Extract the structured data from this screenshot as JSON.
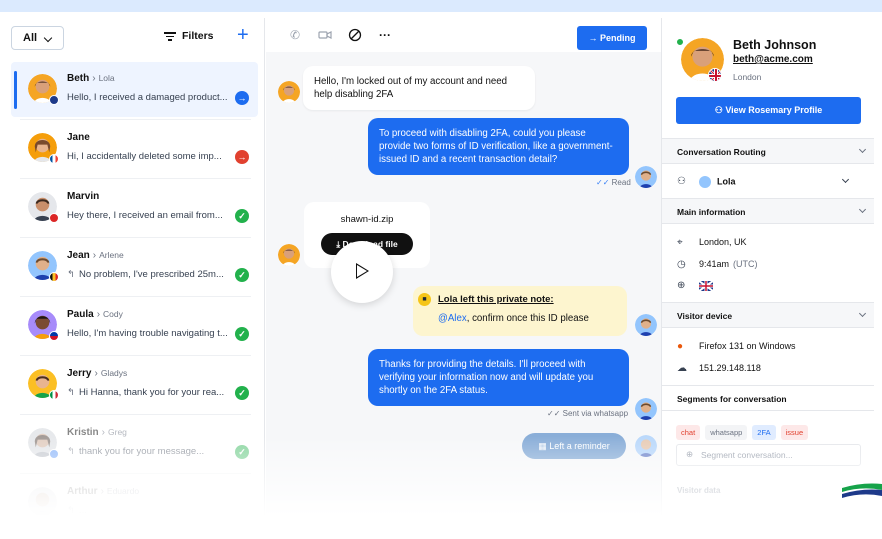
{
  "left": {
    "filter_all": "All",
    "filters_label": "Filters",
    "add_label": "+",
    "conversations": [
      {
        "name": "Beth",
        "agent": "Lola",
        "message": "Hello, I received a damaged product...",
        "status": "blue",
        "status_icon": "→",
        "reply": ""
      },
      {
        "name": "Jane",
        "agent": "",
        "message": "Hi, I accidentally deleted some imp...",
        "status": "red",
        "status_icon": "→",
        "reply": ""
      },
      {
        "name": "Marvin",
        "agent": "",
        "message": "Hey there, I received an email from...",
        "status": "green",
        "status_icon": "✓",
        "reply": ""
      },
      {
        "name": "Jean",
        "agent": "Arlene",
        "message": "No problem, I've prescribed 25m...",
        "status": "green",
        "status_icon": "✓",
        "reply": "↰"
      },
      {
        "name": "Paula",
        "agent": "Cody",
        "message": "Hello, I'm having trouble navigating t...",
        "status": "green",
        "status_icon": "✓",
        "reply": ""
      },
      {
        "name": "Jerry",
        "agent": "Gladys",
        "message": "Hi Hanna, thank you for your rea...",
        "status": "green",
        "status_icon": "✓",
        "reply": "↰"
      },
      {
        "name": "Kristin",
        "agent": "Greg",
        "message": "thank you for your message...",
        "status": "green",
        "status_icon": "✓",
        "reply": "↰"
      },
      {
        "name": "Arthur",
        "agent": "Eduardo",
        "message": "...",
        "status": "green",
        "status_icon": "✓",
        "reply": "↰"
      }
    ]
  },
  "middle": {
    "pending_label": "Pending",
    "msg1": "Hello, I'm locked out of my account and need help disabling 2FA",
    "msg2": "To proceed with disabling 2FA, could you please provide two forms of ID verification, like a government-issued ID and a recent transaction detail?",
    "msg2_meta": "Read",
    "file_name": "shawn-id.zip",
    "download_label": "Download file",
    "note_title": "Lola left this private note:",
    "note_mention": "@Alex",
    "note_body": ", confirm once this ID please",
    "msg3": "Thanks for providing the details. I'll proceed with verifying your information now and will update you shortly on the 2FA status.",
    "msg3_meta": "Sent via whatsapp",
    "reminder_label": "Left a reminder"
  },
  "right": {
    "name": "Beth Johnson",
    "email": "beth@acme.com",
    "location": "London",
    "view_profile": "View Rosemary Profile",
    "routing_title": "Conversation Routing",
    "routing_agent": "Lola",
    "main_info_title": "Main information",
    "city": "London, UK",
    "time": "9:41am",
    "timezone": "(UTC)",
    "device_title": "Visitor device",
    "browser": "Firefox 131 on Windows",
    "ip": "151.29.148.118",
    "segments_title": "Segments for conversation",
    "tags": [
      {
        "label": "chat",
        "bg": "#fde8e8",
        "fg": "#e1412f"
      },
      {
        "label": "whatsapp",
        "bg": "#f3f4f6",
        "fg": "#6b7280"
      },
      {
        "label": "2FA",
        "bg": "#e0ecff",
        "fg": "#1d6cf0"
      },
      {
        "label": "issue",
        "bg": "#fde8e8",
        "fg": "#e1412f"
      }
    ],
    "segment_placeholder": "Segment conversation...",
    "visitor_data_title": "Visitor data"
  }
}
